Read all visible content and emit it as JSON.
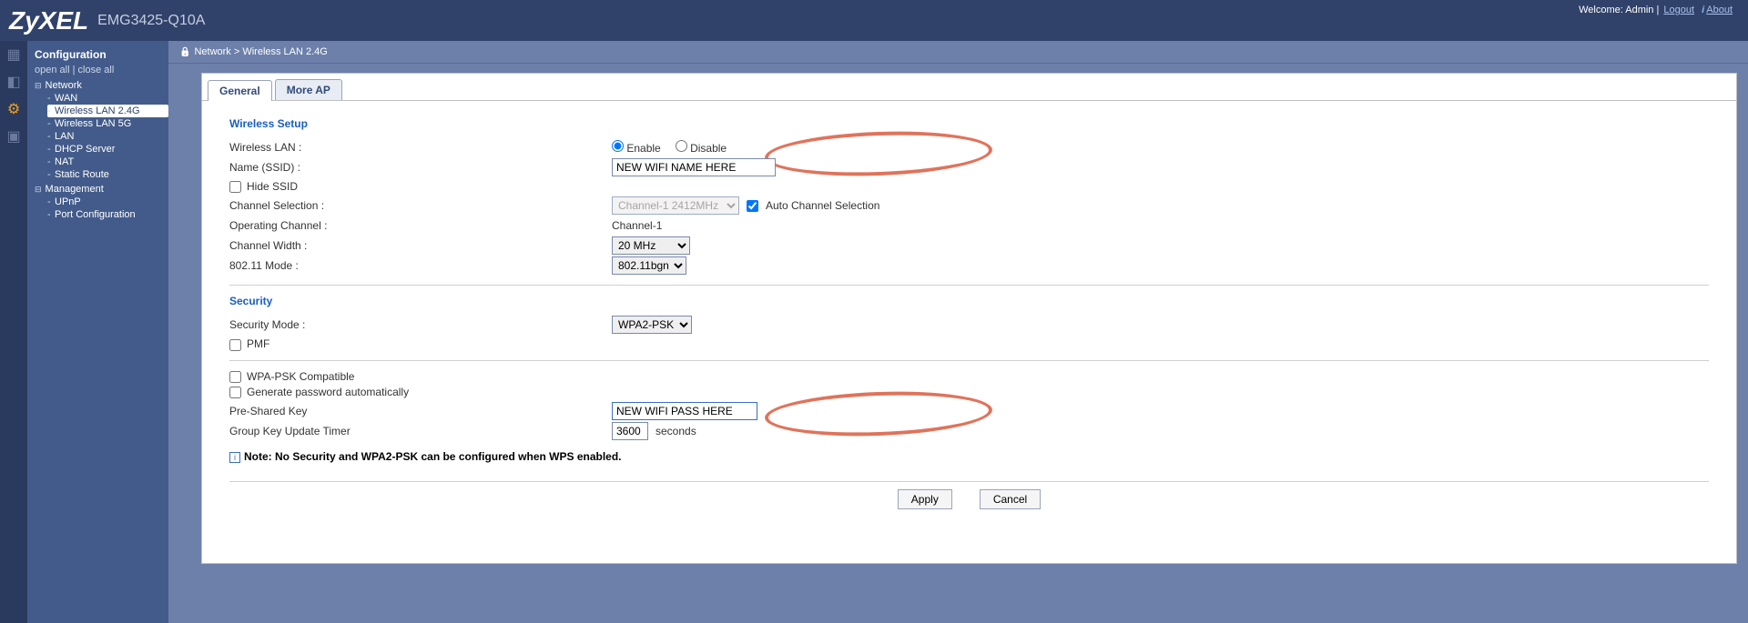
{
  "header": {
    "logo": "ZyXEL",
    "model": "EMG3425-Q10A",
    "welcome": "Welcome: Admin |",
    "logout": "Logout",
    "about": "About"
  },
  "sidebar": {
    "title": "Configuration",
    "open_all": "open all",
    "close_all": "close all",
    "network": {
      "label": "Network",
      "items": [
        "WAN",
        "Wireless LAN 2.4G",
        "Wireless LAN 5G",
        "LAN",
        "DHCP Server",
        "NAT",
        "Static Route"
      ]
    },
    "management": {
      "label": "Management",
      "items": [
        "UPnP",
        "Port Configuration"
      ]
    }
  },
  "breadcrumb": "Network > Wireless LAN 2.4G",
  "tabs": {
    "general": "General",
    "more_ap": "More AP"
  },
  "form": {
    "wireless_setup_title": "Wireless Setup",
    "wireless_lan_label": "Wireless LAN :",
    "enable": "Enable",
    "disable": "Disable",
    "name_ssid_label": "Name (SSID) :",
    "ssid_value": "NEW WIFI NAME HERE",
    "hide_ssid": "Hide SSID",
    "channel_selection_label": "Channel Selection :",
    "channel_selection_value": "Channel-1 2412MHz",
    "auto_channel": "Auto Channel Selection",
    "operating_channel_label": "Operating Channel :",
    "operating_channel_value": "Channel-1",
    "channel_width_label": "Channel Width :",
    "channel_width_value": "20 MHz",
    "mode_label": "802.11 Mode :",
    "mode_value": "802.11bgn",
    "security_title": "Security",
    "security_mode_label": "Security Mode :",
    "security_mode_value": "WPA2-PSK",
    "pmf": "PMF",
    "wpa_psk_compat": "WPA-PSK Compatible",
    "gen_pass_auto": "Generate password automatically",
    "psk_label": "Pre-Shared Key",
    "psk_value": "NEW WIFI PASS HERE",
    "gkut_label": "Group Key Update Timer",
    "gkut_value": "3600",
    "seconds": "seconds",
    "note": "Note: No Security and WPA2-PSK can be configured when WPS enabled.",
    "apply": "Apply",
    "cancel": "Cancel"
  }
}
